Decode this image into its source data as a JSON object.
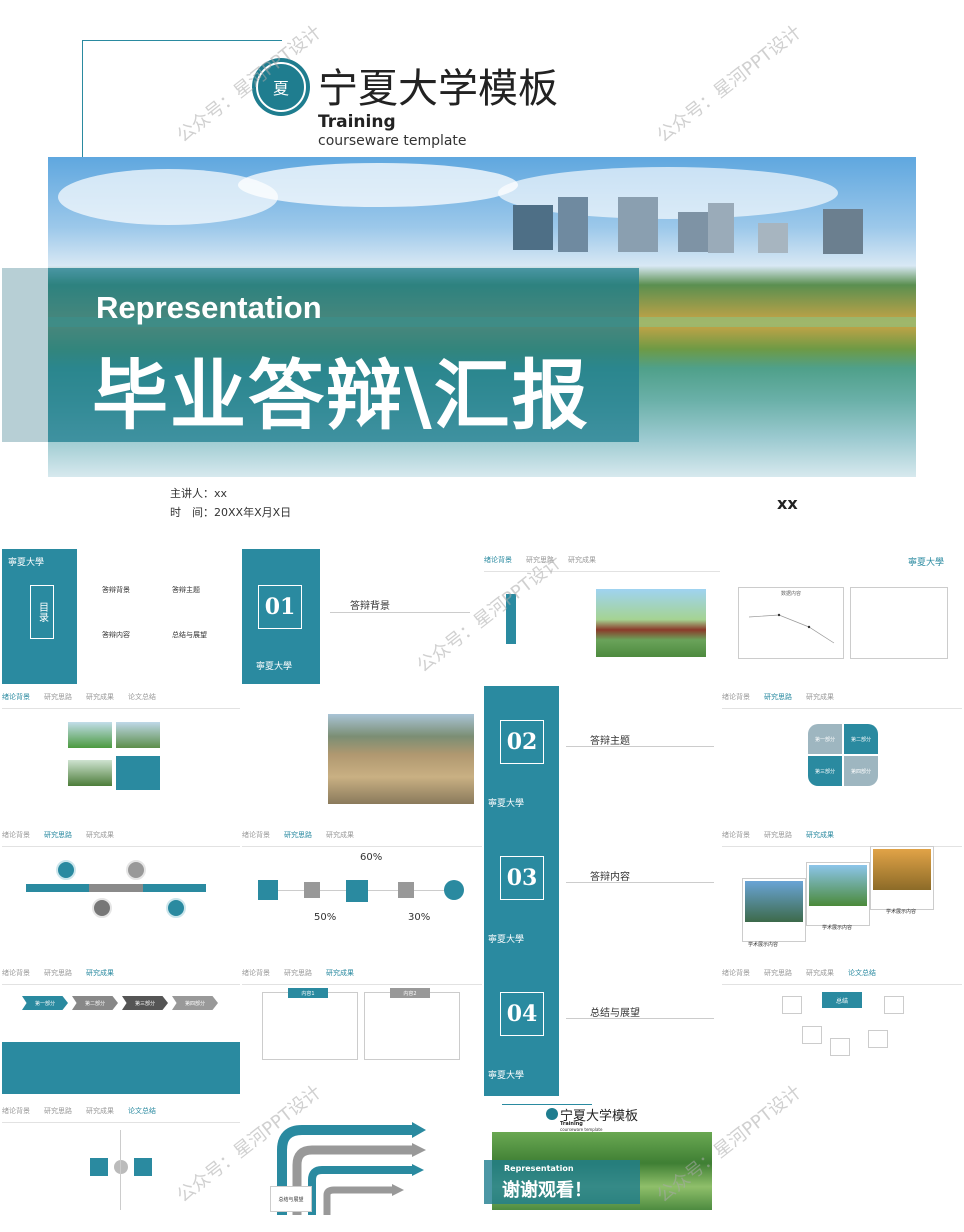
{
  "cover": {
    "school_title": "宁夏大学模板",
    "training": "Training",
    "courseware": "courseware template",
    "representation": "Representation",
    "main_title": "毕业答辩\\汇报",
    "presenter": "主讲人：xx",
    "time": "时　间：20XX年X月X日",
    "xx": "xx"
  },
  "watermark": "公众号：星河PPT设计",
  "nav": [
    "绪论背景",
    "研究思路",
    "研究成果",
    "论文总结"
  ],
  "toc": {
    "label": "目录",
    "items": [
      "答辩背景",
      "答辩主题",
      "答辩内容",
      "总结与展望"
    ]
  },
  "sections": [
    {
      "num": "01",
      "title": "答辩背景"
    },
    {
      "num": "02",
      "title": "答辩主题"
    },
    {
      "num": "03",
      "title": "答辩内容"
    },
    {
      "num": "04",
      "title": "总结与展望"
    }
  ],
  "percents": [
    "60%",
    "50%",
    "30%"
  ],
  "quad": [
    "第一部分",
    "第二部分",
    "第三部分",
    "第四部分"
  ],
  "arrows": [
    "第一部分",
    "第二部分",
    "第三部分",
    "第四部分"
  ],
  "boxes": [
    "内容1",
    "内容2"
  ],
  "center_label": "总结",
  "flow_box": "总结与展望",
  "chart_label": "数据内容",
  "photo_captions": [
    "学术展示内容",
    "学术展示内容",
    "学术展示内容"
  ],
  "ending": {
    "school_title": "宁夏大学模板",
    "training": "Training",
    "courseware": "courseware template",
    "representation": "Representation",
    "thanks": "谢谢观看！"
  },
  "placeholder": "输入您的内容/输入内容",
  "logo_text": "寧夏大學",
  "colors": {
    "teal": "#2a8aa0",
    "grey": "#8a8a8a"
  }
}
